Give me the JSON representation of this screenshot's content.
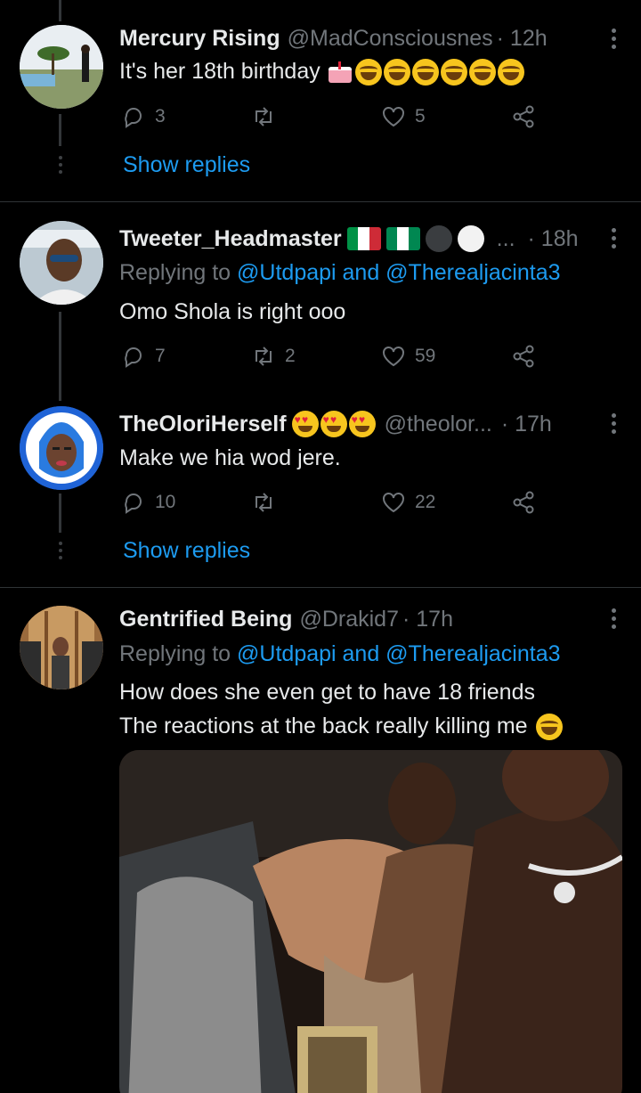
{
  "tweets": [
    {
      "name": "Mercury Rising",
      "handle": "@MadConsciousnes",
      "time": "· 12h",
      "text": "It's her 18th birthday",
      "emoji": [
        "birthday-cake",
        "face-with-tears-of-joy",
        "face-with-tears-of-joy",
        "face-with-tears-of-joy",
        "face-with-tears-of-joy",
        "face-with-tears-of-joy",
        "face-with-tears-of-joy"
      ],
      "replies": "3",
      "retweets": "",
      "likes": "5",
      "show_replies": "Show replies"
    },
    {
      "name": "Tweeter_Headmaster",
      "badges": [
        "flag-italy",
        "flag-nigeria",
        "black-circle",
        "white-circle"
      ],
      "handle": "...",
      "time": "· 18h",
      "replying_prefix": "Replying to",
      "replying_targets": "@Utdpapi and @Therealjacinta3",
      "text": "Omo Shola is right ooo",
      "replies": "7",
      "retweets": "2",
      "likes": "59"
    },
    {
      "name": "TheOloriHerself",
      "emoji": [
        "heart-eyes",
        "heart-eyes",
        "heart-eyes"
      ],
      "handle": "@theolor...",
      "time": "· 17h",
      "text": "Make we hia wod jere.",
      "replies": "10",
      "retweets": "",
      "likes": "22",
      "show_replies": "Show replies"
    },
    {
      "name": "Gentrified Being",
      "handle": "@Drakid7",
      "time": "· 17h",
      "replying_prefix": "Replying to",
      "replying_targets": "@Utdpapi and @Therealjacinta3",
      "text_line1": "How does she even get to have 18 friends",
      "text_line2": "The reactions at the back really killing me",
      "emoji": [
        "face-with-tears-of-joy"
      ],
      "media": "video-thumbnail"
    }
  ],
  "colors": {
    "background": "#000000",
    "text": "#e7e9ea",
    "secondary": "#71767b",
    "link": "#1d9bf0",
    "divider": "#2f3336"
  }
}
